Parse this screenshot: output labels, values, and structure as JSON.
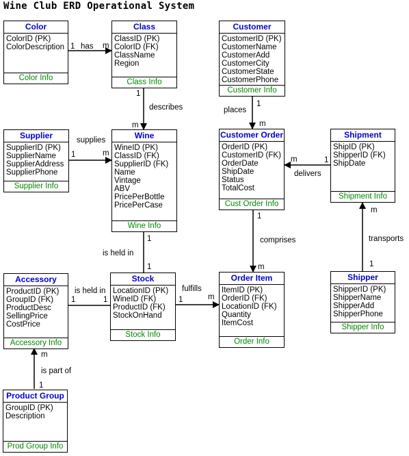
{
  "title": "Wine Club ERD Operational System",
  "entities": {
    "color": {
      "name": "Color",
      "attributes": [
        "ColorID (PK)",
        "ColorDescription"
      ],
      "footer": "Color Info"
    },
    "class": {
      "name": "Class",
      "attributes": [
        "ClassID (PK)",
        "ColorID (FK)",
        "ClassName",
        "Region"
      ],
      "footer": "Class Info"
    },
    "customer": {
      "name": "Customer",
      "attributes": [
        "CustomerID (PK)",
        "CustomerName",
        "CustomerAdd",
        "CustomerCity",
        "CustomerState",
        "CustomerPhone"
      ],
      "footer": "Customer Info"
    },
    "supplier": {
      "name": "Supplier",
      "attributes": [
        "SupplierID (PK)",
        "SupplierName",
        "SupplierAddress",
        "SupplierPhone"
      ],
      "footer": "Supplier Info"
    },
    "wine": {
      "name": "Wine",
      "attributes": [
        "WineID (PK)",
        "ClassID (FK)",
        "SupplierID (FK)",
        "Name",
        "Vintage",
        "ABV",
        "PricePerBottle",
        "PricePerCase"
      ],
      "footer": "Wine Info"
    },
    "customer_order": {
      "name": "Customer Order",
      "attributes": [
        "OrderID (PK)",
        "CustomerID (FK)",
        "OrderDate",
        "ShipDate",
        "Status",
        "TotalCost"
      ],
      "footer": "Cust Order Info"
    },
    "shipment": {
      "name": "Shipment",
      "attributes": [
        "ShipID (PK)",
        "ShipperID (FK)",
        "ShipDate"
      ],
      "footer": "Shipment Info"
    },
    "accessory": {
      "name": "Accessory",
      "attributes": [
        "ProductID (PK)",
        "GroupID (FK)",
        "ProductDesc",
        "SellingPrice",
        "CostPrice"
      ],
      "footer": "Accessory Info"
    },
    "stock": {
      "name": "Stock",
      "attributes": [
        "LocationID (PK)",
        "WineID (FK)",
        "ProductID (FK)",
        "StockOnHand"
      ],
      "footer": "Stock Info"
    },
    "order_item": {
      "name": "Order Item",
      "attributes": [
        "ItemID (PK)",
        "OrderID (FK)",
        "LocationID (FK)",
        "Quantity",
        "ItemCost"
      ],
      "footer": "Order Info"
    },
    "shipper": {
      "name": "Shipper",
      "attributes": [
        "ShipperID (PK)",
        "ShipperName",
        "ShipperAdd",
        "ShipperPhone"
      ],
      "footer": "Shipper Info"
    },
    "product_group": {
      "name": "Product Group",
      "attributes": [
        "GroupID (PK)",
        "Description"
      ],
      "footer": "Prod Group Info"
    }
  },
  "relationships": {
    "has": {
      "verb": "has",
      "from_card": "1",
      "to_card": "m"
    },
    "describes": {
      "verb": "describes",
      "from_card": "1",
      "to_card": "m"
    },
    "places": {
      "verb": "places",
      "from_card": "1",
      "to_card": "m"
    },
    "supplies": {
      "verb": "supplies",
      "from_card": "1",
      "to_card": "m"
    },
    "delivers": {
      "verb": "delivers",
      "from_card": "1",
      "to_card": "m"
    },
    "wine_held_in": {
      "verb": "is held in",
      "from_card": "1",
      "to_card": "1"
    },
    "comprises": {
      "verb": "comprises",
      "from_card": "1",
      "to_card": "m"
    },
    "transports": {
      "verb": "transports",
      "from_card": "1",
      "to_card": "m"
    },
    "accessory_held_in": {
      "verb": "is held in",
      "from_card": "1",
      "to_card": "1"
    },
    "fulfills": {
      "verb": "fulfills",
      "from_card": "1",
      "to_card": "m"
    },
    "is_part_of": {
      "verb": "is part of",
      "from_card": "1",
      "to_card": "m"
    }
  },
  "colors": {
    "header": "#0000cc",
    "footer": "#008800",
    "line": "#000000"
  }
}
